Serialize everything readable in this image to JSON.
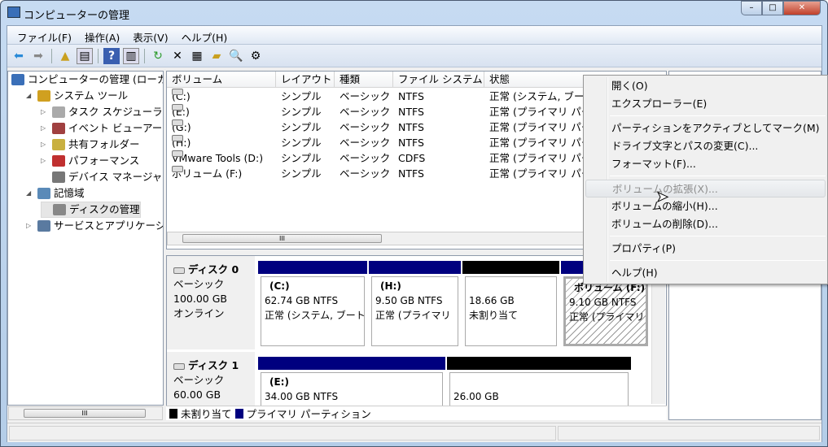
{
  "window": {
    "title": "コンピューターの管理",
    "min": "–",
    "max": "□",
    "close": "✕"
  },
  "menubar": [
    "ファイル(F)",
    "操作(A)",
    "表示(V)",
    "ヘルプ(H)"
  ],
  "tree": [
    {
      "label": "コンピューターの管理 (ローカル)",
      "level": 0,
      "exp": ""
    },
    {
      "label": "システム ツール",
      "level": 1,
      "exp": "◢"
    },
    {
      "label": "タスク スケジューラ",
      "level": 2,
      "exp": "▷"
    },
    {
      "label": "イベント ビューアー",
      "level": 2,
      "exp": "▷"
    },
    {
      "label": "共有フォルダー",
      "level": 2,
      "exp": "▷"
    },
    {
      "label": "パフォーマンス",
      "level": 2,
      "exp": "▷"
    },
    {
      "label": "デバイス マネージャー",
      "level": 2,
      "exp": ""
    },
    {
      "label": "記憶域",
      "level": 1,
      "exp": "◢"
    },
    {
      "label": "ディスクの管理",
      "level": 2,
      "exp": "",
      "selected": true
    },
    {
      "label": "サービスとアプリケーション",
      "level": 1,
      "exp": "▷"
    }
  ],
  "volumes": {
    "columns": [
      "ボリューム",
      "レイアウト",
      "種類",
      "ファイル システム",
      "状態"
    ],
    "rows": [
      [
        "(C:)",
        "シンプル",
        "ベーシック",
        "NTFS",
        "正常 (システム, ブート"
      ],
      [
        "(E:)",
        "シンプル",
        "ベーシック",
        "NTFS",
        "正常 (プライマリ パー"
      ],
      [
        "(G:)",
        "シンプル",
        "ベーシック",
        "NTFS",
        "正常 (プライマリ パー"
      ],
      [
        "(H:)",
        "シンプル",
        "ベーシック",
        "NTFS",
        "正常 (プライマリ パー"
      ],
      [
        "VMware Tools (D:)",
        "シンプル",
        "ベーシック",
        "CDFS",
        "正常 (プライマリ パー"
      ],
      [
        "ボリューム (F:)",
        "シンプル",
        "ベーシック",
        "NTFS",
        "正常 (プライマリ パー"
      ]
    ]
  },
  "disks": [
    {
      "name": "ディスク 0",
      "type": "ベーシック",
      "size": "100.00 GB",
      "state": "オンライン",
      "partitions": [
        {
          "name": "(C:)",
          "size": "62.74 GB NTFS",
          "status": "正常 (システム, ブート",
          "kind": "primary"
        },
        {
          "name": "(H:)",
          "size": "9.50 GB NTFS",
          "status": "正常 (プライマリ",
          "kind": "primary"
        },
        {
          "name": "",
          "size": "18.66 GB",
          "status": "未割り当て",
          "kind": "unallocated"
        },
        {
          "name": "ボリューム (F:)",
          "size": "9.10 GB NTFS",
          "status": "正常 (プライマリ",
          "kind": "primary",
          "selected": true
        }
      ]
    },
    {
      "name": "ディスク 1",
      "type": "ベーシック",
      "size": "60.00 GB",
      "state": "",
      "partitions": [
        {
          "name": "(E:)",
          "size": "34.00 GB NTFS",
          "status": "",
          "kind": "primary"
        },
        {
          "name": "",
          "size": "26.00 GB",
          "status": "",
          "kind": "unallocated"
        }
      ]
    }
  ],
  "legend": [
    "未割り当て",
    "プライマリ パーティション"
  ],
  "colors": {
    "primary": "#00007f",
    "unallocated": "#000000"
  },
  "context_menu": [
    {
      "label": "開く(O)"
    },
    {
      "label": "エクスプローラー(E)"
    },
    {
      "sep": true
    },
    {
      "label": "パーティションをアクティブとしてマーク(M)"
    },
    {
      "label": "ドライブ文字とパスの変更(C)..."
    },
    {
      "label": "フォーマット(F)..."
    },
    {
      "sep": true
    },
    {
      "label": "ボリュームの拡張(X)...",
      "disabled": true
    },
    {
      "label": "ボリュームの縮小(H)..."
    },
    {
      "label": "ボリュームの削除(D)..."
    },
    {
      "sep": true
    },
    {
      "label": "プロパティ(P)"
    },
    {
      "sep": true
    },
    {
      "label": "ヘルプ(H)"
    }
  ]
}
